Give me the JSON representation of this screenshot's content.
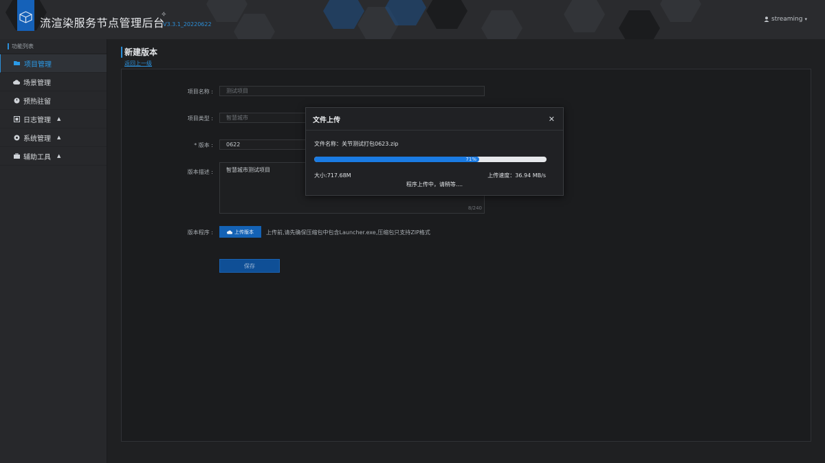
{
  "header": {
    "title": "流渲染服务节点管理后台",
    "version": "V3.3.1_20220622",
    "user": "streaming"
  },
  "sidebar": {
    "heading": "功能列表",
    "items": [
      {
        "label": "项目管理",
        "icon": "folder-open-icon",
        "active": true
      },
      {
        "label": "场景管理",
        "icon": "cloud-icon"
      },
      {
        "label": "预热驻留",
        "icon": "power-icon"
      },
      {
        "label": "日志管理",
        "icon": "log-icon",
        "expandable": true
      },
      {
        "label": "系统管理",
        "icon": "settings-icon",
        "expandable": true
      },
      {
        "label": "辅助工具",
        "icon": "toolbox-icon",
        "expandable": true
      }
    ]
  },
  "page": {
    "title": "新建版本",
    "back_link": "返回上一级"
  },
  "form": {
    "project_name_label": "项目名称 :",
    "project_name_placeholder": "测试项目",
    "project_type_label": "项目类型 :",
    "project_type_placeholder": "智慧城市",
    "version_label": "* 版本 :",
    "version_value": "0622",
    "desc_label": "版本描述 :",
    "desc_value": "智慧城市测试项目",
    "desc_counter": "8/240",
    "program_label": "版本程序 :",
    "upload_button": "上传版本",
    "upload_hint": "上传前,请先确保压缩包中包含Launcher.exe,压缩包只支持ZIP格式",
    "save_button": "保存"
  },
  "modal": {
    "title": "文件上传",
    "file_name_line": "文件名称：关节测试打包0623.zip",
    "progress_percent": 71,
    "progress_label": "71%",
    "size_line": "大小:717.68M",
    "speed_line": "上传速度：36.94 MB/s",
    "status_line": "程序上传中，请稍等...."
  },
  "colors": {
    "accent": "#1a7be3",
    "link": "#2b8fd9",
    "background": "#1f2022"
  }
}
